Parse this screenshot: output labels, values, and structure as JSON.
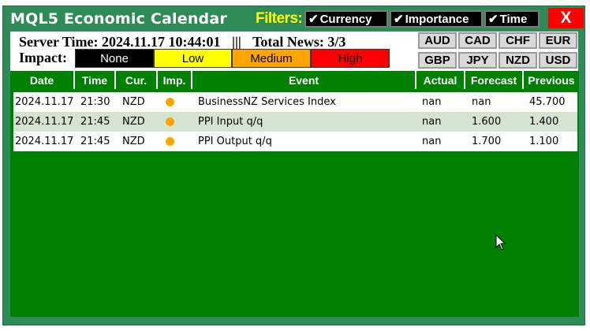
{
  "window": {
    "title": "MQL5 Economic Calendar",
    "close_label": "X"
  },
  "filters": {
    "label": "Filters:",
    "buttons": [
      {
        "label": "Currency",
        "check": "✔"
      },
      {
        "label": "Importance",
        "check": "✔"
      },
      {
        "label": "Time",
        "check": "✔"
      }
    ]
  },
  "info": {
    "server_time": "Server Time: 2024.11.17 10:44:01",
    "separator": "|||",
    "total_news": "Total News: 3/3",
    "impact_label": "Impact:"
  },
  "impact_buttons": [
    {
      "label": "None",
      "bg": "#000000",
      "fg": "#ffffff"
    },
    {
      "label": "Low",
      "bg": "#ffff00",
      "fg": "#000000"
    },
    {
      "label": "Medium",
      "bg": "#ffa500",
      "fg": "#000000"
    },
    {
      "label": "High",
      "bg": "#ff0000",
      "fg": "#000000"
    }
  ],
  "currencies": [
    "AUD",
    "CAD",
    "CHF",
    "EUR",
    "GBP",
    "JPY",
    "NZD",
    "USD"
  ],
  "table": {
    "headers": [
      "Date",
      "Time",
      "Cur.",
      "Imp.",
      "Event",
      "Actual",
      "Forecast",
      "Previous"
    ],
    "rows": [
      {
        "date": "2024.11.17",
        "time": "21:30",
        "cur": "NZD",
        "imp_color": "#ffa500",
        "event": "BusinessNZ Services Index",
        "actual": "nan",
        "forecast": "nan",
        "previous": "45.700"
      },
      {
        "date": "2024.11.17",
        "time": "21:45",
        "cur": "NZD",
        "imp_color": "#ffa500",
        "event": "PPI Input q/q",
        "actual": "nan",
        "forecast": "1.600",
        "previous": "1.400"
      },
      {
        "date": "2024.11.17",
        "time": "21:45",
        "cur": "NZD",
        "imp_color": "#ffa500",
        "event": "PPI Output q/q",
        "actual": "nan",
        "forecast": "1.700",
        "previous": "1.100"
      }
    ]
  }
}
